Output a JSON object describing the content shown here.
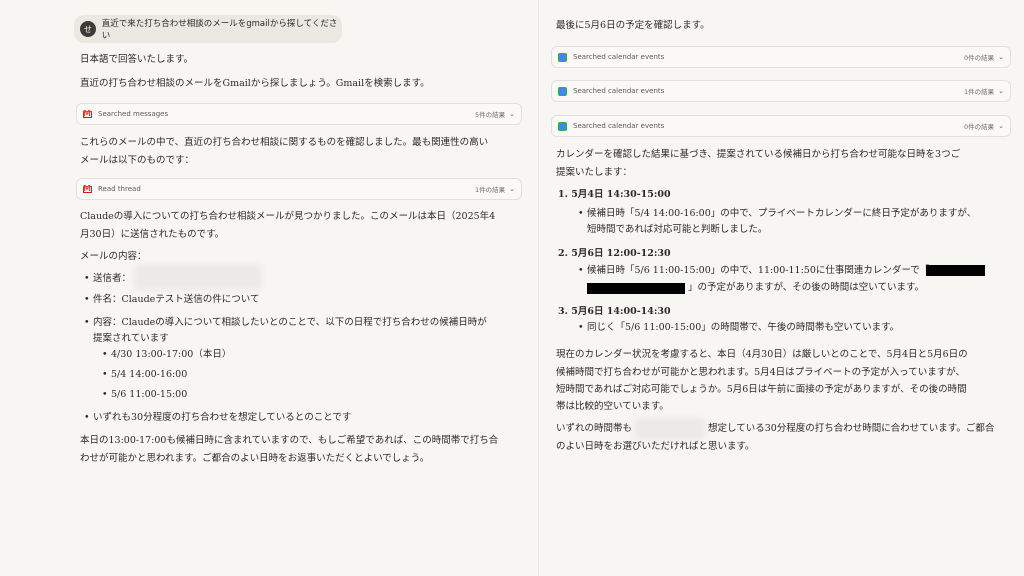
{
  "left": {
    "user_message": "直近で来た打ち合わせ相談のメールをgmailから探してください",
    "avatar_initial": "せ",
    "p1": "日本語で回答いたします。",
    "p2": "直近の打ち合わせ相談のメールをGmailから探しましょう。Gmailを検索します。",
    "tool1": {
      "label": "Searched messages",
      "count": "5件の結果"
    },
    "p3a": "これらのメールの中で、直近の打ち合わせ相談に関するものを確認しました。最も関連性の高い",
    "p3b": "メールは以下のものです：",
    "tool2": {
      "label": "Read thread",
      "count": "1件の結果"
    },
    "p4a": "Claudeの導入についての打ち合わせ相談メールが見つかりました。このメールは本日（2025年4",
    "p4b": "月30日）に送信されたものです。",
    "p5": "メールの内容：",
    "sender": "送信者：",
    "subject": "件名：Claudeテスト送信の件について",
    "content_a": "内容：Claudeの導入について相談したいとのことで、以下の日程で打ち合わせの候補日時が",
    "content_b": "提案されています",
    "dates": [
      "4/30 13:00-17:00（本日）",
      "5/4 14:00-16:00",
      "5/6 11:00-15:00"
    ],
    "assume": "いずれも30分程度の打ち合わせを想定しているとのことです",
    "p6a": "本日の13:00-17:00も候補日時に含まれていますので、もしご希望であれば、この時間帯で打ち合",
    "p6b": "わせが可能かと思われます。ご都合のよい日時をお返事いただくとよいでしょう。"
  },
  "right": {
    "p1": "最後に5月6日の予定を確認します。",
    "tools": [
      {
        "label": "Searched calendar events",
        "count": "0件の結果"
      },
      {
        "label": "Searched calendar events",
        "count": "1件の結果"
      },
      {
        "label": "Searched calendar events",
        "count": "0件の結果"
      }
    ],
    "p2a": "カレンダーを確認した結果に基づき、提案されている候補日から打ち合わせ可能な日時を3つご",
    "p2b": "提案いたします：",
    "items": [
      {
        "title": "1. 5月4日 14:30-15:00",
        "l1": "候補日時「5/4 14:00-16:00」の中で、プライベートカレンダーに終日予定がありますが、",
        "l2": "短時間であれば対応可能と判断しました。"
      },
      {
        "title": "2. 5月6日 12:00-12:30",
        "l1": "候補日時「5/6 11:00-15:00」の中で、11:00-11:50に仕事関連カレンダーで「",
        "l2": "」の予定がありますが、その後の時間は空いています。"
      },
      {
        "title": "3. 5月6日 14:00-14:30",
        "l1": "同じく「5/6 11:00-15:00」の時間帯で、午後の時間帯も空いています。"
      }
    ],
    "p3a": "現在のカレンダー状況を考慮すると、本日（4月30日）は厳しいとのことで、5月4日と5月6日の",
    "p3b": "候補時間で打ち合わせが可能かと思われます。5月4日はプライベートの予定が入っていますが、",
    "p3c": "短時間であればご対応可能でしょうか。5月6日は午前に面接の予定がありますが、その後の時間",
    "p3d": "帯は比較的空いています。",
    "p4a_pre": "いずれの時間帯も",
    "p4a_post": "想定している30分程度の打ち合わせ時間に合わせています。ご都合",
    "p4b": "のよい日時をお選びいただければと思います。"
  }
}
